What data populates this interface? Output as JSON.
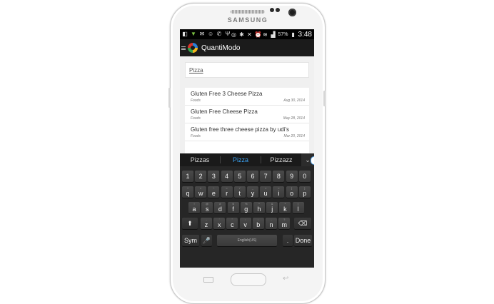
{
  "device": {
    "brand": "SAMSUNG",
    "colors": {
      "body": "#f4f4f4",
      "screen": "#000000"
    }
  },
  "status_bar": {
    "battery": "57%",
    "time": "3:48",
    "icons_left": [
      "notification-icon",
      "download-icon",
      "mail-icon",
      "chat-icon",
      "phone-icon",
      "usb-icon"
    ],
    "icons_right": [
      "nfc-icon",
      "bluetooth-icon",
      "mute-icon",
      "alarm-icon",
      "wifi-icon",
      "signal-icon",
      "battery-icon"
    ]
  },
  "app_bar": {
    "title": "QuantiModo",
    "colors": {
      "background": "#1b1b1b"
    }
  },
  "search": {
    "value": "Pizza"
  },
  "results": [
    {
      "name": "Gluten Free 3 Cheese Pizza",
      "category": "Foods",
      "date": "Aug 30, 2014"
    },
    {
      "name": "Gluten Free Cheese Pizza",
      "category": "Foods",
      "date": "May 28, 2014"
    },
    {
      "name": "Gluten free three cheese pizza by udi's",
      "category": "Foods",
      "date": "Mar 20, 2014"
    }
  ],
  "suggestions": {
    "items": [
      "Pizzas",
      "Pizza",
      "Pizzazz"
    ],
    "active": "Pizza",
    "colors": {
      "active": "#3aa0f0"
    }
  },
  "keyboard": {
    "numbers": [
      "1",
      "2",
      "3",
      "4",
      "5",
      "6",
      "7",
      "8",
      "9",
      "0"
    ],
    "row1": [
      {
        "key": "q",
        "sup": "+"
      },
      {
        "key": "w",
        "sup": "×"
      },
      {
        "key": "e",
        "sup": "÷"
      },
      {
        "key": "r",
        "sup": "="
      },
      {
        "key": "t",
        "sup": "/"
      },
      {
        "key": "y",
        "sup": "_"
      },
      {
        "key": "u",
        "sup": "<"
      },
      {
        "key": "i",
        "sup": ">"
      },
      {
        "key": "o",
        "sup": "["
      },
      {
        "key": "p",
        "sup": "]"
      }
    ],
    "row2": [
      {
        "key": "a",
        "sup": "!"
      },
      {
        "key": "s",
        "sup": "@"
      },
      {
        "key": "d",
        "sup": "#"
      },
      {
        "key": "f",
        "sup": "$"
      },
      {
        "key": "g",
        "sup": "%"
      },
      {
        "key": "h",
        "sup": "^"
      },
      {
        "key": "j",
        "sup": "&"
      },
      {
        "key": "k",
        "sup": "*"
      },
      {
        "key": "l",
        "sup": "("
      }
    ],
    "row3": [
      {
        "key": "z",
        "sup": "-"
      },
      {
        "key": "x",
        "sup": "'"
      },
      {
        "key": "c",
        "sup": "\""
      },
      {
        "key": "v",
        "sup": ":"
      },
      {
        "key": "b",
        "sup": ";"
      },
      {
        "key": "n",
        "sup": ","
      },
      {
        "key": "m",
        "sup": "?"
      }
    ],
    "shift": "⬆",
    "backspace": "⌫",
    "sym": "Sym",
    "voice": "🎤",
    "space_label": "English(US)",
    "period": ".",
    "done": "Done"
  }
}
